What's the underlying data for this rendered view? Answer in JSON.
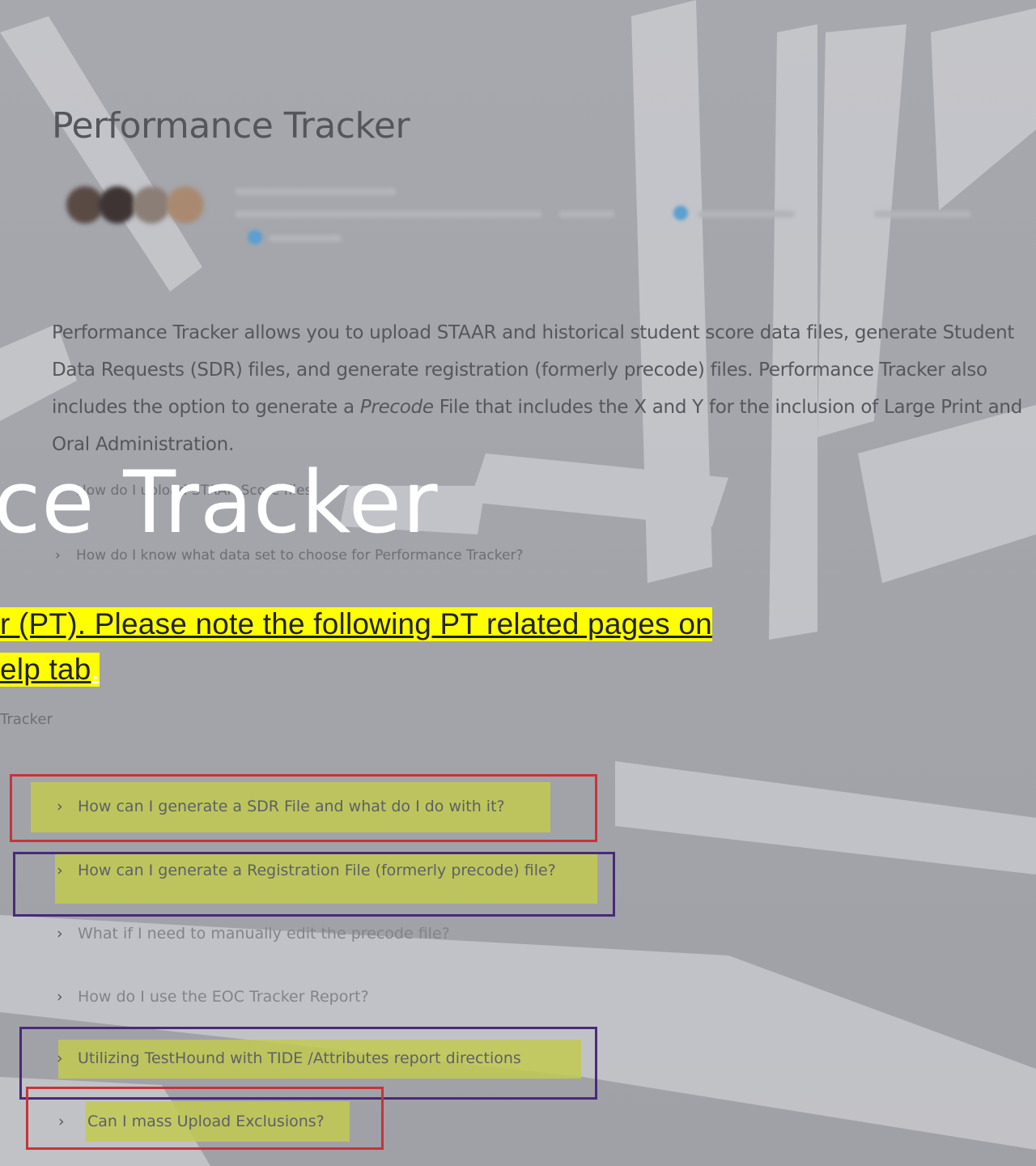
{
  "page_title": "Performance Tracker",
  "intro": {
    "part1": "Performance Tracker allows you to upload STAAR and historical student score data files, generate Student Data Requests (SDR) files, and generate registration (formerly precode) files. Performance Tracker also includes the option to generate a ",
    "italic": "Precode",
    "part2": " File that includes the X and Y for the inclusion of Large Print and Oral Administration."
  },
  "upper_faq": {
    "item1": "How do I upload STAAR Score files",
    "item2": "How do I know what data set to choose for Performance Tracker?"
  },
  "slide_title": "ce Tracker",
  "highlight": {
    "line1": "r (PT). Please note the following PT related pages on",
    "line2": "elp tab",
    "line2_suffix": "."
  },
  "breadcrumb": "Tracker",
  "faq": {
    "chevron": "›",
    "items": [
      "How can I generate a SDR File and what do I do with it?",
      "How can I generate a Registration File (formerly precode) file?",
      "What if I need to manually edit the precode file?",
      "How do I use the EOC Tracker Report?",
      "Utilizing TestHound with TIDE /Attributes report directions",
      "Can I mass Upload Exclusions?"
    ]
  },
  "colors": {
    "highlight_yellow": "#ffff00",
    "faq_highlight": "#c2ca50",
    "box_red": "#c6343a",
    "box_purple": "#4a2a78",
    "background": "#a3a5ab"
  }
}
